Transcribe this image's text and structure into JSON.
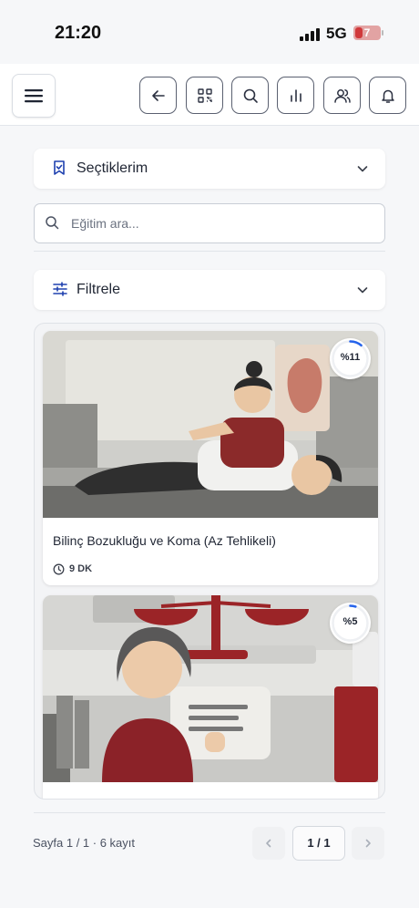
{
  "status_bar": {
    "time": "21:20",
    "network": "5G",
    "battery": "7"
  },
  "toolbar": {
    "icons": [
      "menu-icon",
      "back-arrow-icon",
      "qr-code-icon",
      "search-icon",
      "chart-bars-icon",
      "users-icon",
      "bell-icon"
    ]
  },
  "favorites": {
    "label": "Seçtiklerim"
  },
  "search": {
    "placeholder": "Eğitim ara...",
    "value": ""
  },
  "filter": {
    "label": "Filtrele"
  },
  "courses": [
    {
      "title": "Bilinç Bozukluğu ve Koma (Az Tehlikeli)",
      "duration": "9 DK",
      "progress_label": "%11",
      "progress": 0.11
    },
    {
      "title": "",
      "duration": "",
      "progress_label": "%5",
      "progress": 0.05
    }
  ],
  "pagination": {
    "summary": "Sayfa 1 / 1 · 6 kayıt",
    "current": "1 / 1"
  },
  "colors": {
    "accent": "#1e40af",
    "progress_ring": "#2563eb",
    "text": "#1f2533"
  }
}
